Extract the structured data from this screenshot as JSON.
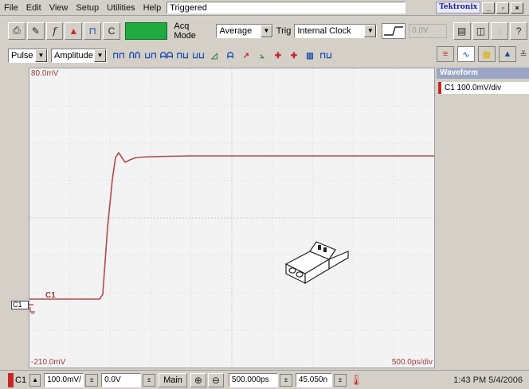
{
  "menu": {
    "items": [
      "File",
      "Edit",
      "View",
      "Setup",
      "Utilities",
      "Help"
    ],
    "status": "Triggered",
    "brand": "Tektronix"
  },
  "toolbar": {
    "acq_mode_label": "Acq Mode",
    "acq_mode_value": "Average",
    "trig_label": "Trig",
    "trig_value": "Internal Clock",
    "level_value": "0.0V",
    "c_label": "C"
  },
  "measure_bar": {
    "measure_type": "Pulse",
    "measure_param": "Amplitude"
  },
  "scope": {
    "top_label": "80.0mV",
    "bottom_label": "-210.0mV",
    "timebase_label": "500.0ps/div",
    "channel_trace_label": "C1",
    "marker_label": "C1",
    "trace_color": "#b24a4a"
  },
  "right_panel": {
    "header": "Waveform",
    "item": "C1 100.0mV/div"
  },
  "bottom": {
    "channel": "C1",
    "scale": "100.0mV/",
    "offset": "0.0V",
    "main_label": "Main",
    "position": "500.000ps",
    "delay": "45.050n",
    "time": "1:43 PM 5/4/2006"
  }
}
